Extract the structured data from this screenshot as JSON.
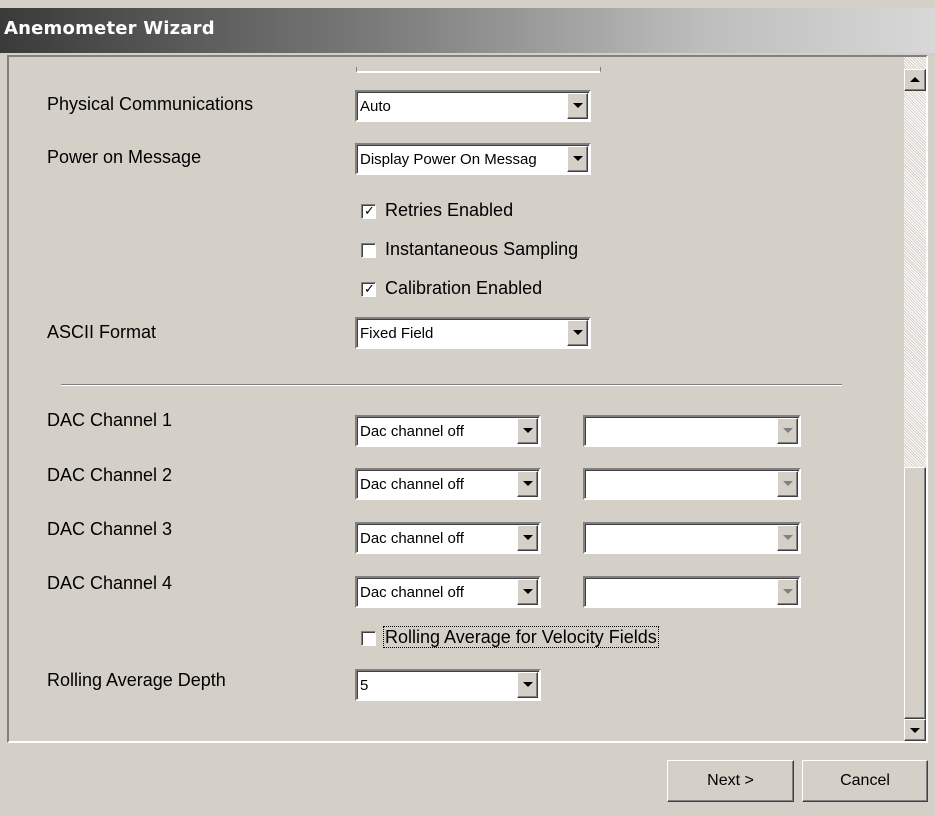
{
  "window": {
    "title": "Anemometer Wizard"
  },
  "form": {
    "physical_communications": {
      "label": "Physical Communications",
      "value": "Auto"
    },
    "power_on_message": {
      "label": "Power on Message",
      "value": "Display Power On Messag"
    },
    "retries_enabled": {
      "label": "Retries Enabled",
      "checked": true,
      "mark": "✓"
    },
    "instantaneous_sampling": {
      "label": "Instantaneous Sampling",
      "checked": false,
      "mark": ""
    },
    "calibration_enabled": {
      "label": "Calibration Enabled",
      "checked": true,
      "mark": "✓"
    },
    "ascii_format": {
      "label": "ASCII Format",
      "value": "Fixed Field"
    },
    "dac_channels": [
      {
        "label": "DAC Channel 1",
        "value": "Dac channel off",
        "secondary_value": ""
      },
      {
        "label": "DAC Channel 2",
        "value": "Dac channel off",
        "secondary_value": ""
      },
      {
        "label": "DAC Channel 3",
        "value": "Dac channel off",
        "secondary_value": ""
      },
      {
        "label": "DAC Channel 4",
        "value": "Dac channel off",
        "secondary_value": ""
      }
    ],
    "rolling_average_velocity": {
      "label": "Rolling Average for Velocity Fields",
      "checked": false,
      "mark": ""
    },
    "rolling_average_depth": {
      "label": "Rolling Average Depth",
      "value": "5"
    }
  },
  "buttons": {
    "next": "Next >",
    "cancel": "Cancel"
  },
  "icons": {
    "dropdown": "chevron-down-icon",
    "scroll_up": "arrow-up-icon",
    "scroll_down": "arrow-down-icon",
    "checkmark": "checkmark-icon"
  }
}
